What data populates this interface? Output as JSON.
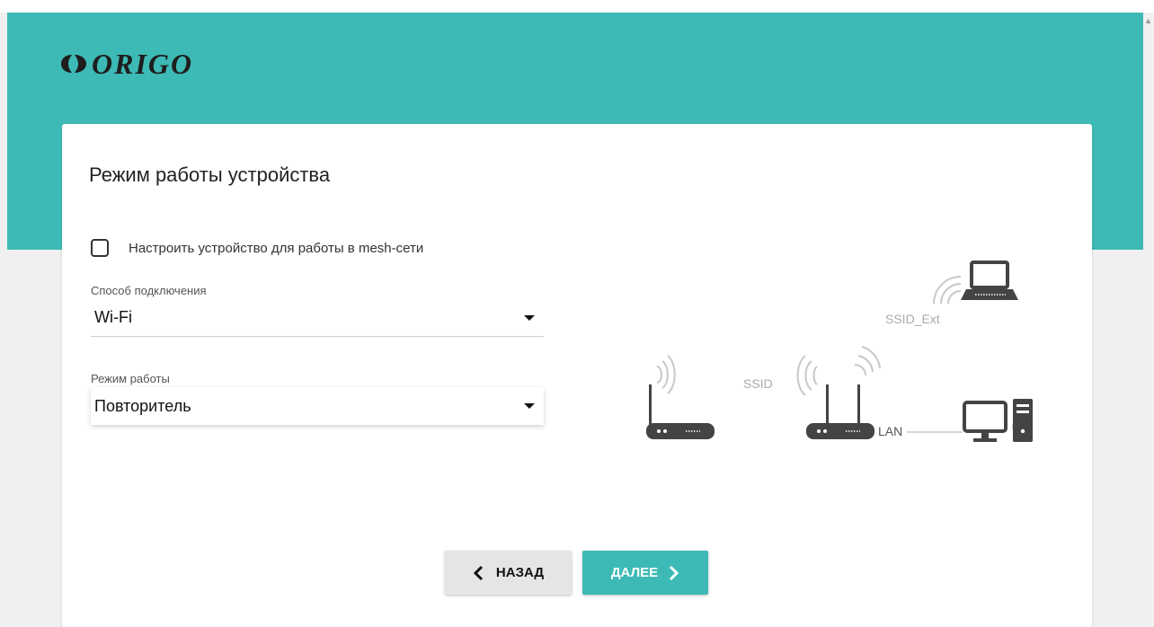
{
  "brand": {
    "logo_text": "ORIGO"
  },
  "page": {
    "title": "Режим работы устройства"
  },
  "mesh": {
    "label": "Настроить устройство для работы в mesh-сети",
    "checked": false
  },
  "connection": {
    "label": "Способ подключения",
    "value": "Wi-Fi"
  },
  "mode": {
    "label": "Режим работы",
    "value": "Повторитель"
  },
  "diagram": {
    "ssid": "SSID",
    "ssid_ext": "SSID_Ext",
    "lan": "LAN"
  },
  "buttons": {
    "back": "НАЗАД",
    "next": "ДАЛЕЕ"
  },
  "colors": {
    "accent": "#3dbab5",
    "device": "#444444",
    "wave": "#c8c8c8"
  }
}
